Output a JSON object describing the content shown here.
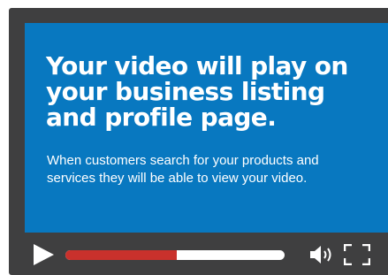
{
  "screen": {
    "headline": "Your video will play on your business listing and profile page.",
    "description": "When customers search for your products and services they will be able to view your video."
  },
  "player": {
    "progress_fraction": 0.51,
    "icons": {
      "play": "play-icon",
      "volume": "volume-icon",
      "fullscreen": "fullscreen-icon"
    }
  },
  "colors": {
    "frame": "#3f3f40",
    "screen": "#0878c0",
    "progress_fill": "#c9312c",
    "progress_track": "#ffffff",
    "text": "#ffffff"
  }
}
